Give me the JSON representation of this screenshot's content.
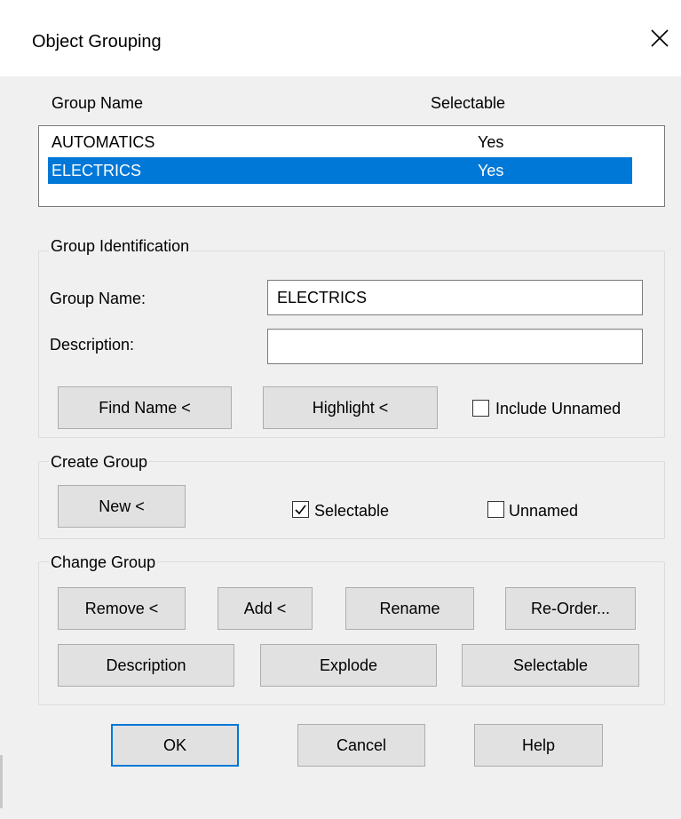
{
  "dialog": {
    "title": "Object Grouping"
  },
  "list": {
    "headers": {
      "name": "Group  Name",
      "selectable": "Selectable"
    },
    "rows": [
      {
        "name": "AUTOMATICS",
        "selectable": "Yes",
        "selected": false
      },
      {
        "name": "ELECTRICS",
        "selectable": "Yes",
        "selected": true
      }
    ]
  },
  "identification": {
    "legend": "Group Identification",
    "group_name_label": "Group  Name:",
    "group_name_value": "ELECTRICS",
    "description_label": "Description:",
    "description_value": "",
    "find_name": "Find Name <",
    "highlight": "Highlight <",
    "include_unnamed": "Include Unnamed",
    "include_unnamed_checked": false
  },
  "create": {
    "legend": "Create Group",
    "new": "New <",
    "selectable": "Selectable",
    "selectable_checked": true,
    "unnamed": "Unnamed",
    "unnamed_checked": false
  },
  "change": {
    "legend": "Change Group",
    "remove": "Remove <",
    "add": "Add <",
    "rename": "Rename",
    "reorder": "Re-Order...",
    "description": "Description",
    "explode": "Explode",
    "selectable": "Selectable"
  },
  "footer": {
    "ok": "OK",
    "cancel": "Cancel",
    "help": "Help"
  },
  "colors": {
    "selection": "#0078d7",
    "default_border": "#0078d7",
    "dialog_bg": "#f0f0f0"
  },
  "icons": {
    "close": "close-icon",
    "check": "check-icon"
  }
}
